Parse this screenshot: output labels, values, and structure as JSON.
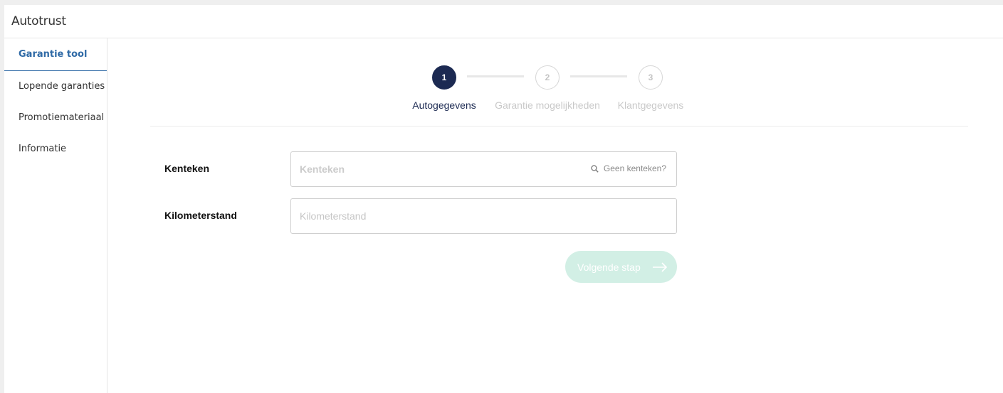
{
  "app": {
    "title": "Autotrust"
  },
  "sidebar": {
    "items": [
      {
        "label": "Garantie tool",
        "active": true
      },
      {
        "label": "Lopende garanties",
        "active": false
      },
      {
        "label": "Promotiemateriaal",
        "active": false
      },
      {
        "label": "Informatie",
        "active": false
      }
    ]
  },
  "stepper": {
    "current": 1,
    "steps": [
      {
        "number": "1",
        "label": "Autogegevens",
        "state": "active"
      },
      {
        "number": "2",
        "label": "Garantie mogelijkheden",
        "state": "inactive"
      },
      {
        "number": "3",
        "label": "Klantgegevens",
        "state": "inactive"
      }
    ]
  },
  "form": {
    "kenteken": {
      "label": "Kenteken",
      "placeholder": "Kenteken",
      "value": "",
      "no_plate_link": "Geen kenteken?",
      "icon": "search-icon"
    },
    "kilometerstand": {
      "label": "Kilometerstand",
      "placeholder": "Kilometerstand",
      "value": ""
    }
  },
  "actions": {
    "next_label": "Volgende stap",
    "next_icon": "arrow-right-icon",
    "next_enabled": false
  },
  "colors": {
    "accent": "#2f6aa6",
    "step_active": "#1c2a52",
    "button_disabled": "#d2efe5"
  }
}
